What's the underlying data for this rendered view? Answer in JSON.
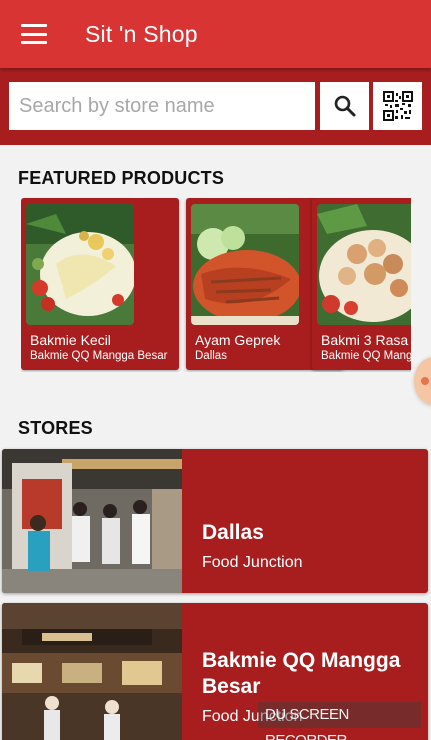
{
  "app": {
    "title": "Sit 'n Shop"
  },
  "colors": {
    "primary": "#d93434",
    "primary_dark": "#a81e1e",
    "background": "#f2f2f2"
  },
  "icons": {
    "menu": "hamburger-menu-icon",
    "search": "search-icon",
    "qr": "qr-code-icon"
  },
  "search": {
    "placeholder": "Search by store name",
    "value": ""
  },
  "featured": {
    "title": "FEATURED PRODUCTS",
    "products": [
      {
        "name": "Bakmie Kecil",
        "store": "Bakmie QQ Mangga Besar"
      },
      {
        "name": "Ayam Geprek",
        "store": "Dallas"
      },
      {
        "name": "Bakmi 3 Rasa",
        "store": "Bakmie QQ Mangga Besar"
      }
    ]
  },
  "stores": {
    "title": "STORES",
    "items": [
      {
        "name": "Dallas",
        "location": "Food Junction"
      },
      {
        "name": "Bakmie QQ Mangga Besar",
        "location": "Food Junction"
      }
    ]
  },
  "watermark": "DU SCREEN RECORDER"
}
